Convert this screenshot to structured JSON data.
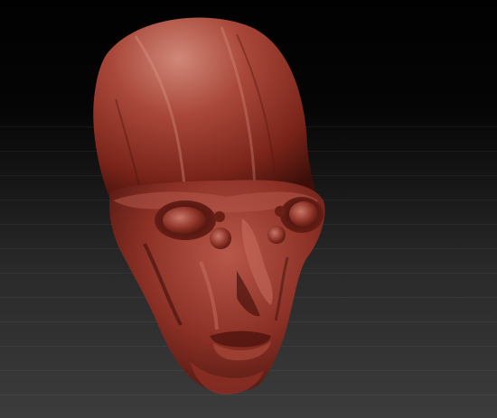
{
  "canvas": {
    "background_top": "#010101",
    "background_bottom": "#3c3c3c",
    "gradient_banding": true
  },
  "model": {
    "subject": "alien-head-sculpt",
    "material_color": "#9e3a2e",
    "highlight_color": "#c9766a",
    "shadow_color": "#3e0f0a"
  }
}
